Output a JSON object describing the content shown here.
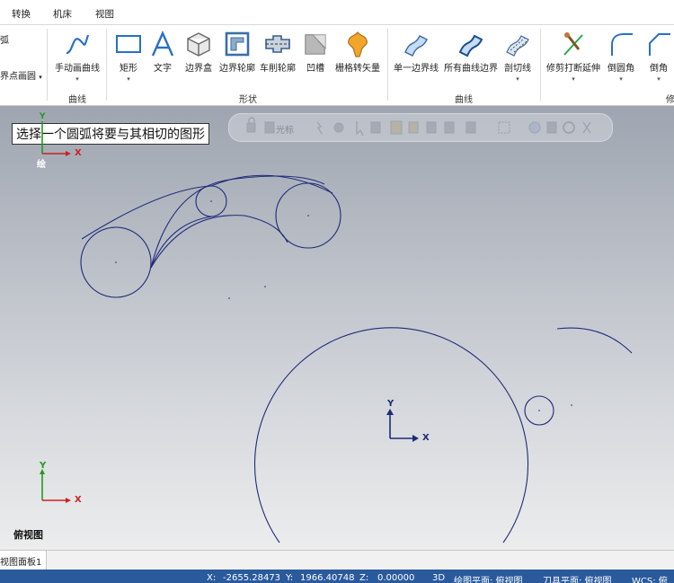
{
  "menu": {
    "tabs": [
      "转换",
      "机床",
      "视图"
    ]
  },
  "ribbon": {
    "partial_left": {
      "top_label": "弧",
      "bottom_label": "界点画圆"
    },
    "groups": [
      {
        "name": "曲线",
        "buttons": [
          {
            "label": "手动画曲线",
            "icon": "freehand-curve-icon"
          }
        ]
      },
      {
        "name": "形状",
        "buttons": [
          {
            "label": "矩形",
            "icon": "rectangle-icon"
          },
          {
            "label": "文字",
            "icon": "text-icon"
          },
          {
            "label": "边界盒",
            "icon": "bounding-box-icon"
          },
          {
            "label": "边界轮廓",
            "icon": "boundary-profile-icon"
          },
          {
            "label": "车削轮廓",
            "icon": "turn-profile-icon"
          },
          {
            "label": "凹槽",
            "icon": "groove-icon"
          },
          {
            "label": "栅格转矢量",
            "icon": "raster-to-vector-icon"
          }
        ]
      },
      {
        "name": "曲线",
        "buttons": [
          {
            "label": "单一边界线",
            "icon": "single-edge-curve-icon"
          },
          {
            "label": "所有曲线边界",
            "icon": "all-edge-curves-icon"
          },
          {
            "label": "剖切线",
            "icon": "slice-icon"
          }
        ]
      },
      {
        "name": "修",
        "buttons": [
          {
            "label": "修剪打断延伸",
            "icon": "trim-break-extend-icon"
          },
          {
            "label": "倒圆角",
            "icon": "fillet-icon"
          },
          {
            "label": "倒角",
            "icon": "chamfer-icon"
          }
        ]
      }
    ]
  },
  "viewport": {
    "prompt": "选择一个圆弧将要与其相切的图形",
    "float_toolbar": {
      "cursor_label": "光标"
    },
    "view_name": "俯视图",
    "draw_label": "绘",
    "axis": {
      "x": "X",
      "y": "Y"
    },
    "colors": {
      "geometry": "#1f2a7a",
      "x_axis": "#cc2222",
      "y_axis": "#229922",
      "origin_axes": "#1f2a7a"
    }
  },
  "panel_tabs": [
    "视图面板1"
  ],
  "status": {
    "x_label": "X:",
    "x_value": "-2655.28473",
    "y_label": "Y:",
    "y_value": "1966.40748",
    "z_label": "Z:",
    "z_value": "0.00000",
    "mode": "3D",
    "draw_plane": "绘图平面: 俯视图",
    "tool_plane": "刀具平面: 俯视图",
    "wcs": "WCS: 俯"
  }
}
